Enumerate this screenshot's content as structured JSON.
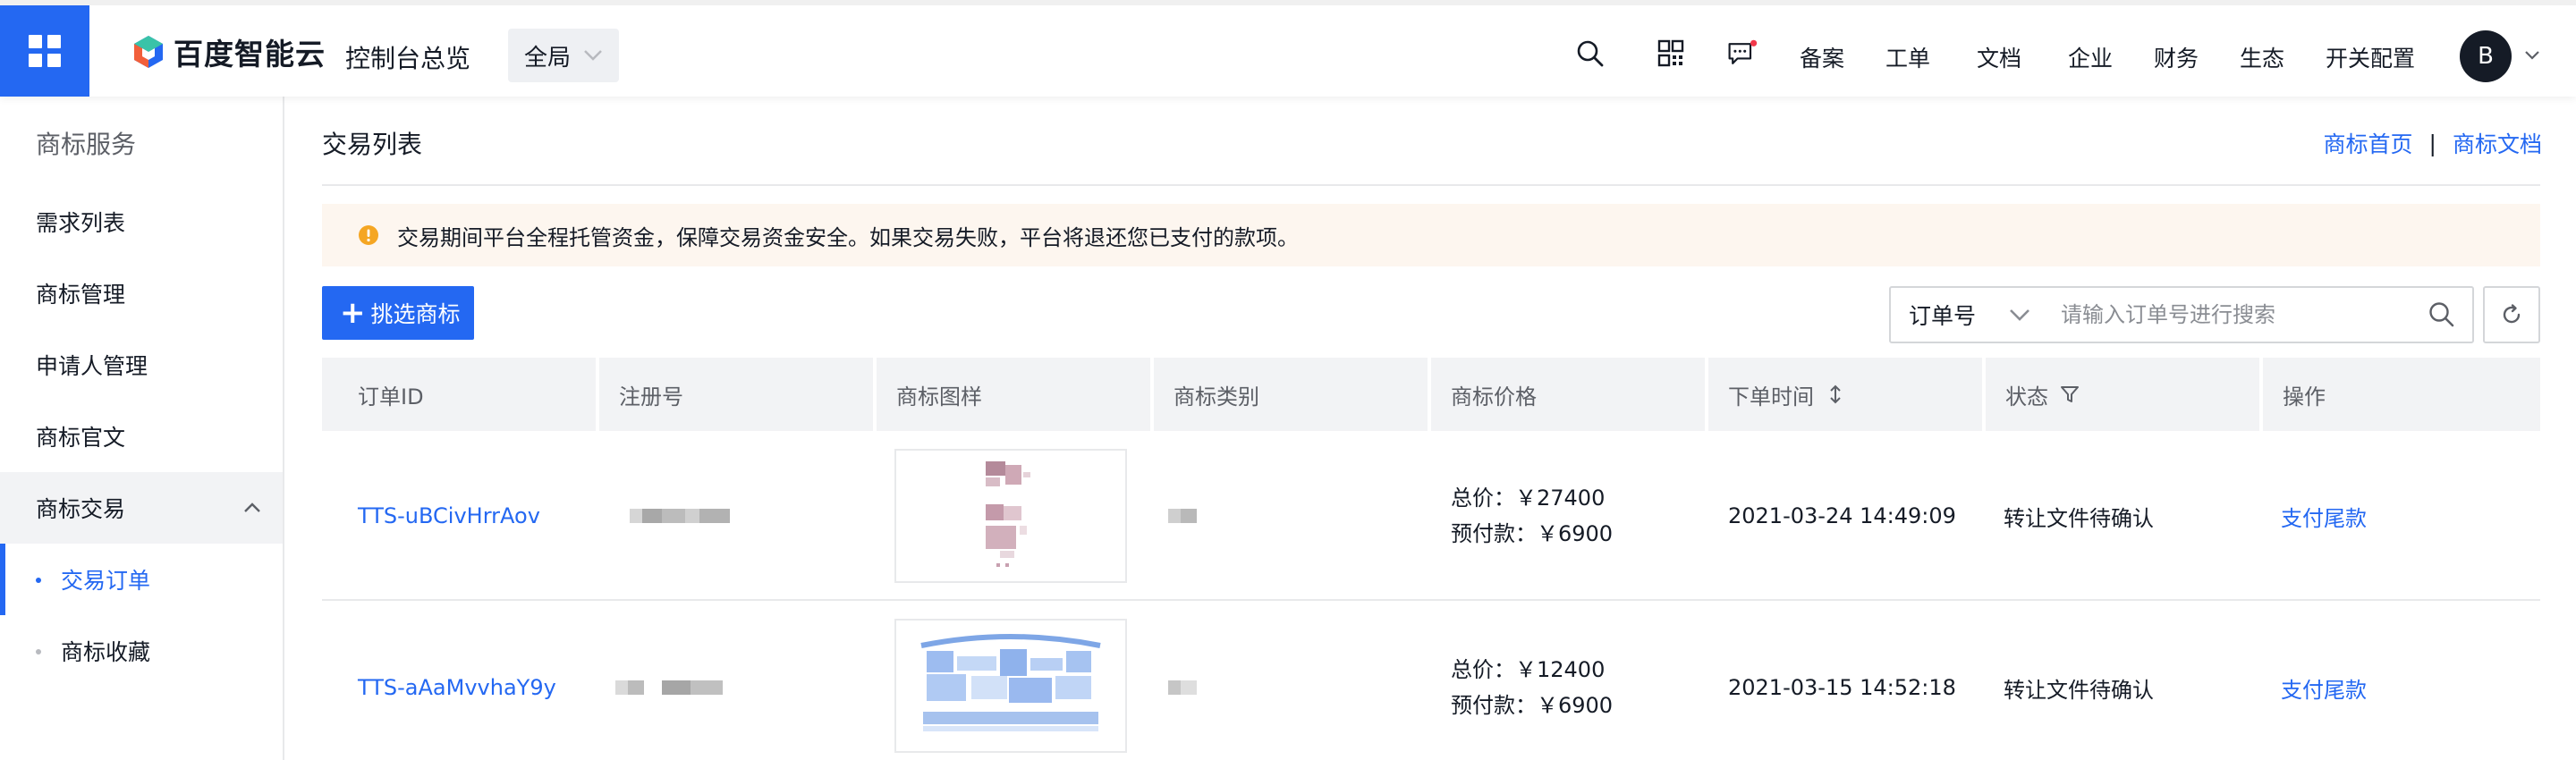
{
  "header": {
    "brand_name": "百度智能云",
    "console_title": "控制台总览",
    "region": "全局",
    "nav": [
      "备案",
      "工单",
      "文档",
      "企业",
      "财务",
      "生态",
      "开关配置"
    ],
    "avatar_letter": "B",
    "accent_color": "#2468f2",
    "notification_dot_color": "#f2384a"
  },
  "sidebar": {
    "title": "商标服务",
    "items": [
      {
        "label": "需求列表"
      },
      {
        "label": "商标管理"
      },
      {
        "label": "申请人管理"
      },
      {
        "label": "商标官文"
      },
      {
        "label": "商标交易",
        "expanded": true
      }
    ],
    "sub_items": [
      {
        "label": "交易订单",
        "active": true
      },
      {
        "label": "商标收藏",
        "active": false
      }
    ]
  },
  "main": {
    "title": "交易列表",
    "links": [
      "商标首页",
      "商标文档"
    ],
    "link_separator": "|",
    "notice": "交易期间平台全程托管资金，保障交易资金安全。如果交易失败，平台将退还您已支付的款项。",
    "add_button_label": "挑选商标",
    "search": {
      "field": "订单号",
      "placeholder": "请输入订单号进行搜索"
    },
    "table": {
      "columns": [
        "订单ID",
        "注册号",
        "商标图样",
        "商标类别",
        "商标价格",
        "下单时间",
        "状态",
        "操作"
      ],
      "rows": [
        {
          "order_id": "TTS-uBCivHrrAov",
          "total_price": "总价：￥27400",
          "prepay": "预付款：￥6900",
          "order_time": "2021-03-24 14:49:09",
          "status": "转让文件待确认",
          "action": "支付尾款"
        },
        {
          "order_id": "TTS-aAaMvvhaY9y",
          "total_price": "总价：￥12400",
          "prepay": "预付款：￥6900",
          "order_time": "2021-03-15 14:52:18",
          "status": "转让文件待确认",
          "action": "支付尾款"
        }
      ]
    }
  }
}
